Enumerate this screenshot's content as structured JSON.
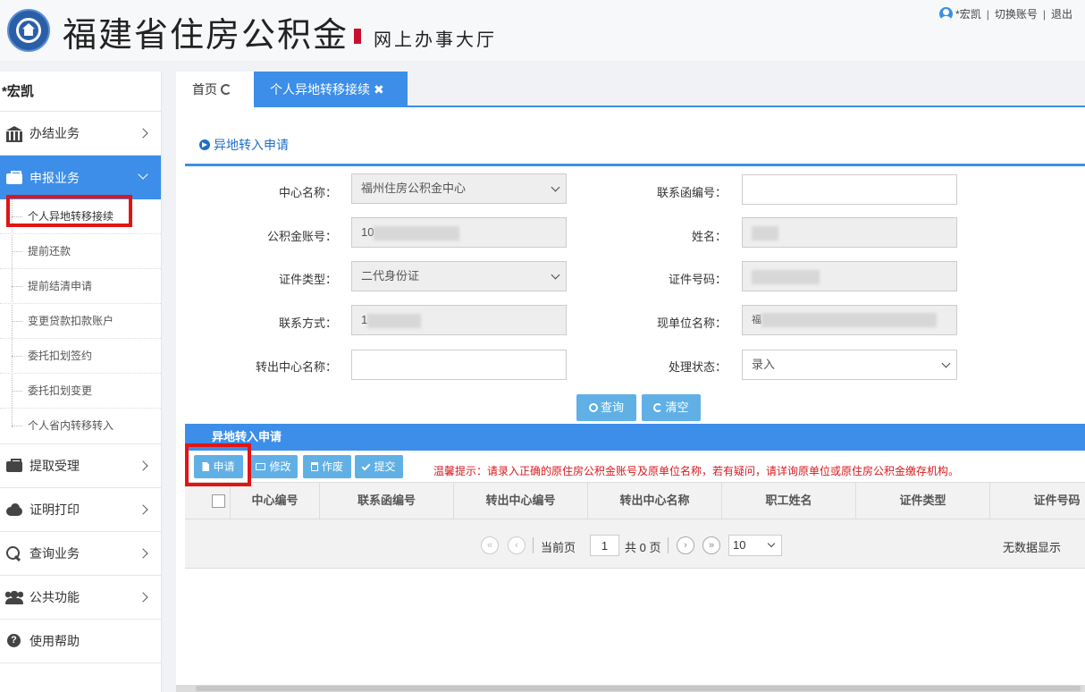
{
  "header": {
    "title": "福建省住房公积金",
    "subtitle": "网上办事大厅",
    "user_name": "*宏凯",
    "switch_account": "切换账号",
    "logout": "退出",
    "separator": "|"
  },
  "sidebar": {
    "user": "*宏凯",
    "items": [
      {
        "label": "办结业务",
        "icon": "bank-icon"
      },
      {
        "label": "申报业务",
        "icon": "briefcase-icon",
        "active": true
      },
      {
        "label": "提取受理",
        "icon": "briefcase-icon"
      },
      {
        "label": "证明打印",
        "icon": "cloud-icon"
      },
      {
        "label": "查询业务",
        "icon": "search-icon"
      },
      {
        "label": "公共功能",
        "icon": "users-icon"
      },
      {
        "label": "使用帮助",
        "icon": "help-icon"
      }
    ],
    "sub_items": [
      "个人异地转移接续",
      "提前还款",
      "提前结清申请",
      "变更贷款扣款账户",
      "委托扣划签约",
      "委托扣划变更",
      "个人省内转移转入"
    ]
  },
  "tabs": [
    {
      "label": "首页"
    },
    {
      "label": "个人异地转移接续"
    }
  ],
  "section_title": "异地转入申请",
  "form": {
    "center_name_label": "中心名称：",
    "center_name_value": "福州住房公积金中心",
    "letter_no_label": "联系函编号：",
    "letter_no_value": "",
    "account_label": "公积金账号：",
    "account_value": "10",
    "name_label": "姓名：",
    "id_type_label": "证件类型：",
    "id_type_value": "二代身份证",
    "id_no_label": "证件号码：",
    "contact_label": "联系方式：",
    "contact_value": "1",
    "employer_label": "现单位名称：",
    "employer_value": "福",
    "out_center_label": "转出中心名称：",
    "out_center_value": "",
    "status_label": "处理状态：",
    "status_value": "录入"
  },
  "buttons": {
    "query": "查询",
    "clear": "清空",
    "apply": "申请",
    "edit": "修改",
    "void": "作废",
    "submit": "提交"
  },
  "grid": {
    "title": "异地转入申请",
    "tip": "温馨提示：请录入正确的原住房公积金账号及原单位名称，若有疑问，请详询原单位或原住房公积金缴存机构。",
    "columns": [
      "中心编号",
      "联系函编号",
      "转出中心编号",
      "转出中心名称",
      "职工姓名",
      "证件类型",
      "证件号码"
    ]
  },
  "pager": {
    "first": "«",
    "prev": "‹",
    "next": "›",
    "last": "»",
    "current_label": "当前页",
    "page": "1",
    "total_label": "共 0 页",
    "page_size": "10",
    "no_data": "无数据显示"
  },
  "colors": {
    "accent": "#3c8ee8",
    "button": "#60b0e6",
    "tip": "#d9191f",
    "highlight_box": "#e21414"
  }
}
